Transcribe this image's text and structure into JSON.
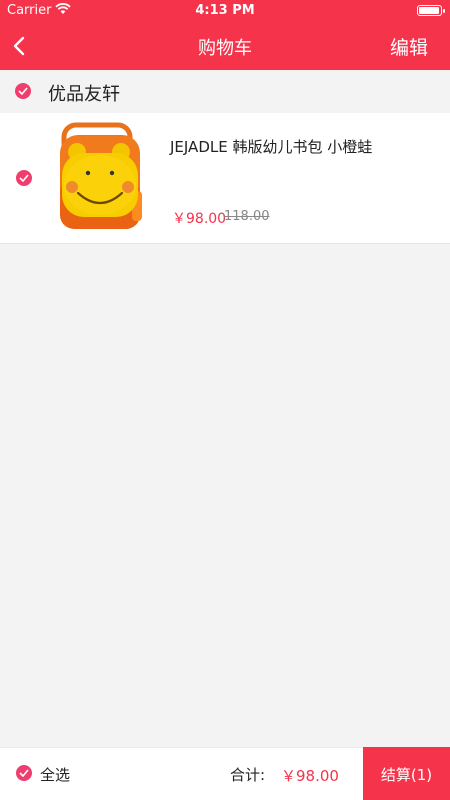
{
  "status_bar": {
    "carrier": "Carrier",
    "time": "4:13 PM",
    "battery_level": 0.95
  },
  "nav": {
    "title": "购物车",
    "edit_label": "编辑"
  },
  "store": {
    "name": "优品友轩",
    "selected": true
  },
  "cart_items": [
    {
      "title": "JEJADLE 韩版幼儿书包 小橙蛙",
      "price": "￥98.00",
      "original_price": "118.00",
      "selected": true
    }
  ],
  "footer": {
    "select_all_label": "全选",
    "total_label": "合计:",
    "total_value": "￥98.00",
    "checkout_label": "结算(1)"
  },
  "colors": {
    "accent": "#f5334b",
    "check": "#ef3d6e",
    "background": "#f3f3f3"
  }
}
